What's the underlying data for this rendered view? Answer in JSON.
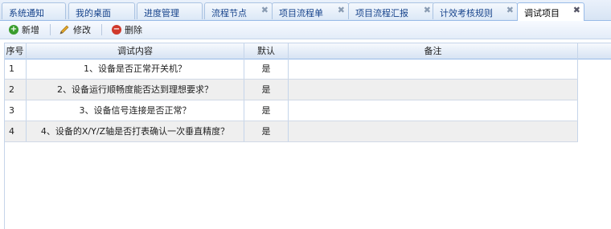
{
  "tabs": [
    {
      "label": "系统通知",
      "closable": false,
      "active": false
    },
    {
      "label": "我的桌面",
      "closable": false,
      "active": false
    },
    {
      "label": "进度管理",
      "closable": false,
      "active": false
    },
    {
      "label": "流程节点",
      "closable": true,
      "active": false
    },
    {
      "label": "项目流程单",
      "closable": true,
      "active": false
    },
    {
      "label": "项目流程汇报",
      "closable": true,
      "active": false
    },
    {
      "label": "计效考核规则",
      "closable": true,
      "active": false
    },
    {
      "label": "调试项目",
      "closable": true,
      "active": true
    }
  ],
  "tab_close_glyph": "✖",
  "toolbar": {
    "add_label": "新增",
    "edit_label": "修改",
    "delete_label": "删除"
  },
  "grid": {
    "columns": [
      "序号",
      "调试内容",
      "默认",
      "备注"
    ],
    "rows": [
      {
        "no": "1",
        "content": "1、设备是否正常开关机？",
        "default": "是",
        "note": ""
      },
      {
        "no": "2",
        "content": "2、设备运行顺畅度能否达到理想要求？",
        "default": "是",
        "note": ""
      },
      {
        "no": "3",
        "content": "3、设备信号连接是否正常？",
        "default": "是",
        "note": ""
      },
      {
        "no": "4",
        "content": "4、设备的X/Y/Z轴是否打表确认一次垂直精度？",
        "default": "是",
        "note": ""
      }
    ]
  },
  "colors": {
    "add_icon": "#3a9d2e",
    "delete_icon": "#d0392b",
    "header_border": "#99bbe8",
    "alt_row": "#efefef"
  },
  "icons": {
    "add": "plus-circle-icon",
    "edit": "pencil-icon",
    "delete": "minus-circle-icon"
  }
}
